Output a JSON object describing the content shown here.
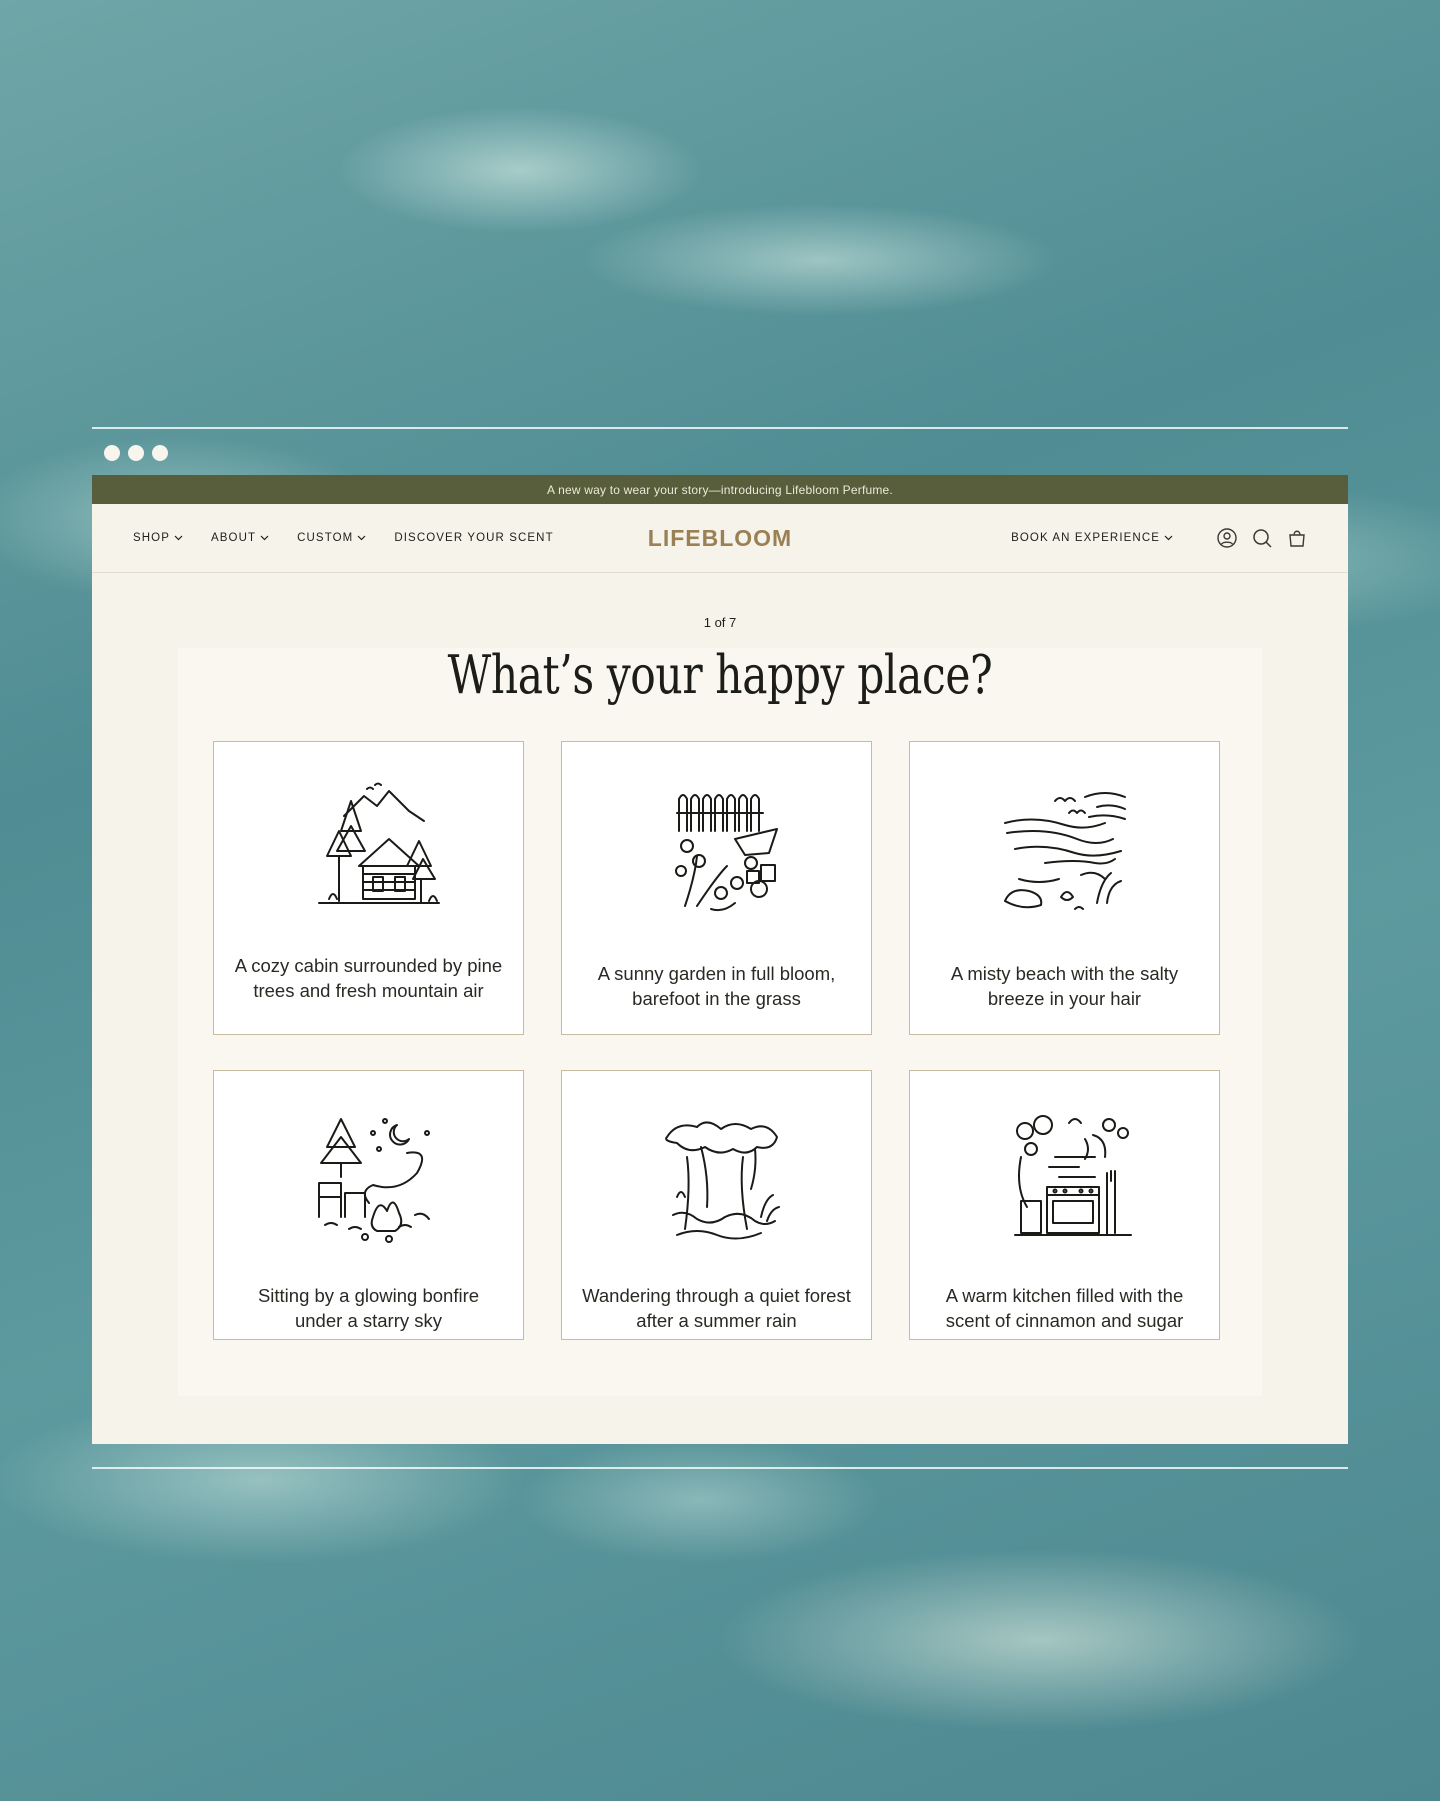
{
  "window": {
    "announcement": "A new way to wear your story—introducing Lifebloom Perfume."
  },
  "nav": {
    "items": [
      {
        "label": "SHOP"
      },
      {
        "label": "ABOUT"
      },
      {
        "label": "CUSTOM"
      },
      {
        "label": "DISCOVER YOUR SCENT"
      }
    ],
    "logo": "LIFEBLOOM",
    "book_label": "BOOK AN EXPERIENCE",
    "icons": [
      "account-icon",
      "search-icon",
      "cart-icon"
    ]
  },
  "quiz": {
    "counter": "1 of 7",
    "question": "What’s your happy place?",
    "options": [
      {
        "label": "A cozy cabin surrounded by pine trees and fresh mountain air",
        "icon": "cabin-illustration"
      },
      {
        "label": "A sunny garden in full bloom, barefoot in the grass",
        "icon": "garden-illustration"
      },
      {
        "label": "A misty beach with the salty breeze in your hair",
        "icon": "beach-illustration"
      },
      {
        "label": "Sitting by a glowing bonfire under a starry sky",
        "icon": "bonfire-illustration"
      },
      {
        "label": "Wandering through a quiet forest after a summer rain",
        "icon": "forest-illustration"
      },
      {
        "label": "A warm kitchen filled with the scent of cinnamon and sugar",
        "icon": "kitchen-illustration"
      }
    ]
  },
  "colors": {
    "announcement_bg": "#585d3c",
    "logo": "#9a8155",
    "page_bg": "#f6f3ea",
    "card_border": "#c7bca2"
  }
}
